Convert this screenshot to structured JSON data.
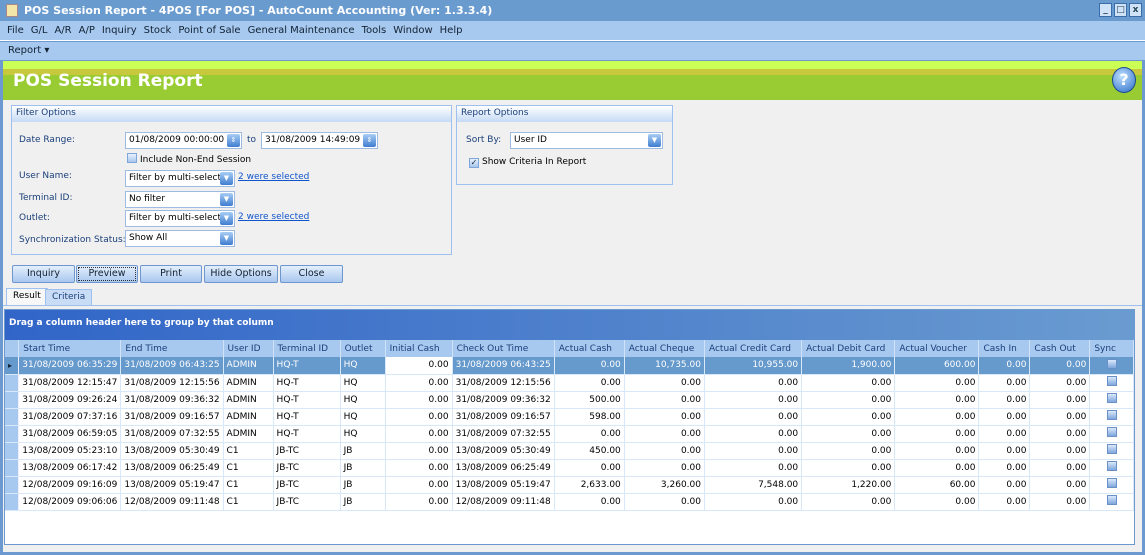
{
  "window": {
    "title": "POS Session Report - 4POS [For POS] - AutoCount Accounting (Ver: 1.3.3.4)"
  },
  "menu": [
    "File",
    "G/L",
    "A/R",
    "A/P",
    "Inquiry",
    "Stock",
    "Point of Sale",
    "General Maintenance",
    "Tools",
    "Window",
    "Help"
  ],
  "toolbar": {
    "report": "Report ▾"
  },
  "banner": {
    "title": "POS Session Report",
    "help": "?"
  },
  "filter": {
    "title": "Filter Options",
    "date_range_label": "Date Range:",
    "date_from": "01/08/2009 00:00:00",
    "to": "to",
    "date_to": "31/08/2009 14:49:09",
    "include_non_end": "Include Non-End Session",
    "include_non_end_checked": false,
    "user_name_label": "User Name:",
    "user_name_value": "Filter by multi-select",
    "user_name_link": "2 were selected",
    "terminal_label": "Terminal ID:",
    "terminal_value": "No filter",
    "outlet_label": "Outlet:",
    "outlet_value": "Filter by multi-select",
    "outlet_link": "2 were selected",
    "sync_label": "Synchronization Status:",
    "sync_value": "Show All"
  },
  "report_options": {
    "title": "Report Options",
    "sort_by_label": "Sort By:",
    "sort_by_value": "User ID",
    "show_criteria": "Show Criteria In Report",
    "show_criteria_checked": true
  },
  "buttons": {
    "inquiry": "Inquiry",
    "preview": "Preview",
    "print": "Print",
    "hide_options": "Hide Options",
    "close": "Close"
  },
  "tabs": {
    "result": "Result",
    "criteria": "Criteria",
    "active": "Result"
  },
  "grid": {
    "group_panel": "Drag a column header here to group by that column",
    "columns": [
      "Start Time",
      "End Time",
      "User ID",
      "Terminal ID",
      "Outlet",
      "Initial Cash",
      "Check Out Time",
      "Actual Cash",
      "Actual Cheque",
      "Actual Credit Card",
      "Actual Debit Card",
      "Actual Voucher",
      "Cash In",
      "Cash Out",
      "Sync"
    ],
    "rows": [
      [
        "31/08/2009 06:35:29",
        "31/08/2009 06:43:25",
        "ADMIN",
        "HQ-T",
        "HQ",
        "0.00",
        "31/08/2009 06:43:25",
        "0.00",
        "10,735.00",
        "10,955.00",
        "1,900.00",
        "600.00",
        "0.00",
        "0.00"
      ],
      [
        "31/08/2009 12:15:47",
        "31/08/2009 12:15:56",
        "ADMIN",
        "HQ-T",
        "HQ",
        "0.00",
        "31/08/2009 12:15:56",
        "0.00",
        "0.00",
        "0.00",
        "0.00",
        "0.00",
        "0.00",
        "0.00"
      ],
      [
        "31/08/2009 09:26:24",
        "31/08/2009 09:36:32",
        "ADMIN",
        "HQ-T",
        "HQ",
        "0.00",
        "31/08/2009 09:36:32",
        "500.00",
        "0.00",
        "0.00",
        "0.00",
        "0.00",
        "0.00",
        "0.00"
      ],
      [
        "31/08/2009 07:37:16",
        "31/08/2009 09:16:57",
        "ADMIN",
        "HQ-T",
        "HQ",
        "0.00",
        "31/08/2009 09:16:57",
        "598.00",
        "0.00",
        "0.00",
        "0.00",
        "0.00",
        "0.00",
        "0.00"
      ],
      [
        "31/08/2009 06:59:05",
        "31/08/2009 07:32:55",
        "ADMIN",
        "HQ-T",
        "HQ",
        "0.00",
        "31/08/2009 07:32:55",
        "0.00",
        "0.00",
        "0.00",
        "0.00",
        "0.00",
        "0.00",
        "0.00"
      ],
      [
        "13/08/2009 05:23:10",
        "13/08/2009 05:30:49",
        "C1",
        "JB-TC",
        "JB",
        "0.00",
        "13/08/2009 05:30:49",
        "450.00",
        "0.00",
        "0.00",
        "0.00",
        "0.00",
        "0.00",
        "0.00"
      ],
      [
        "13/08/2009 06:17:42",
        "13/08/2009 06:25:49",
        "C1",
        "JB-TC",
        "JB",
        "0.00",
        "13/08/2009 06:25:49",
        "0.00",
        "0.00",
        "0.00",
        "0.00",
        "0.00",
        "0.00",
        "0.00"
      ],
      [
        "12/08/2009 09:16:09",
        "13/08/2009 05:19:47",
        "C1",
        "JB-TC",
        "JB",
        "0.00",
        "13/08/2009 05:19:47",
        "2,633.00",
        "3,260.00",
        "7,548.00",
        "1,220.00",
        "60.00",
        "0.00",
        "0.00"
      ],
      [
        "12/08/2009 09:06:06",
        "12/08/2009 09:11:48",
        "C1",
        "JB-TC",
        "JB",
        "0.00",
        "12/08/2009 09:11:48",
        "0.00",
        "0.00",
        "0.00",
        "0.00",
        "0.00",
        "0.00",
        "0.00"
      ]
    ]
  }
}
